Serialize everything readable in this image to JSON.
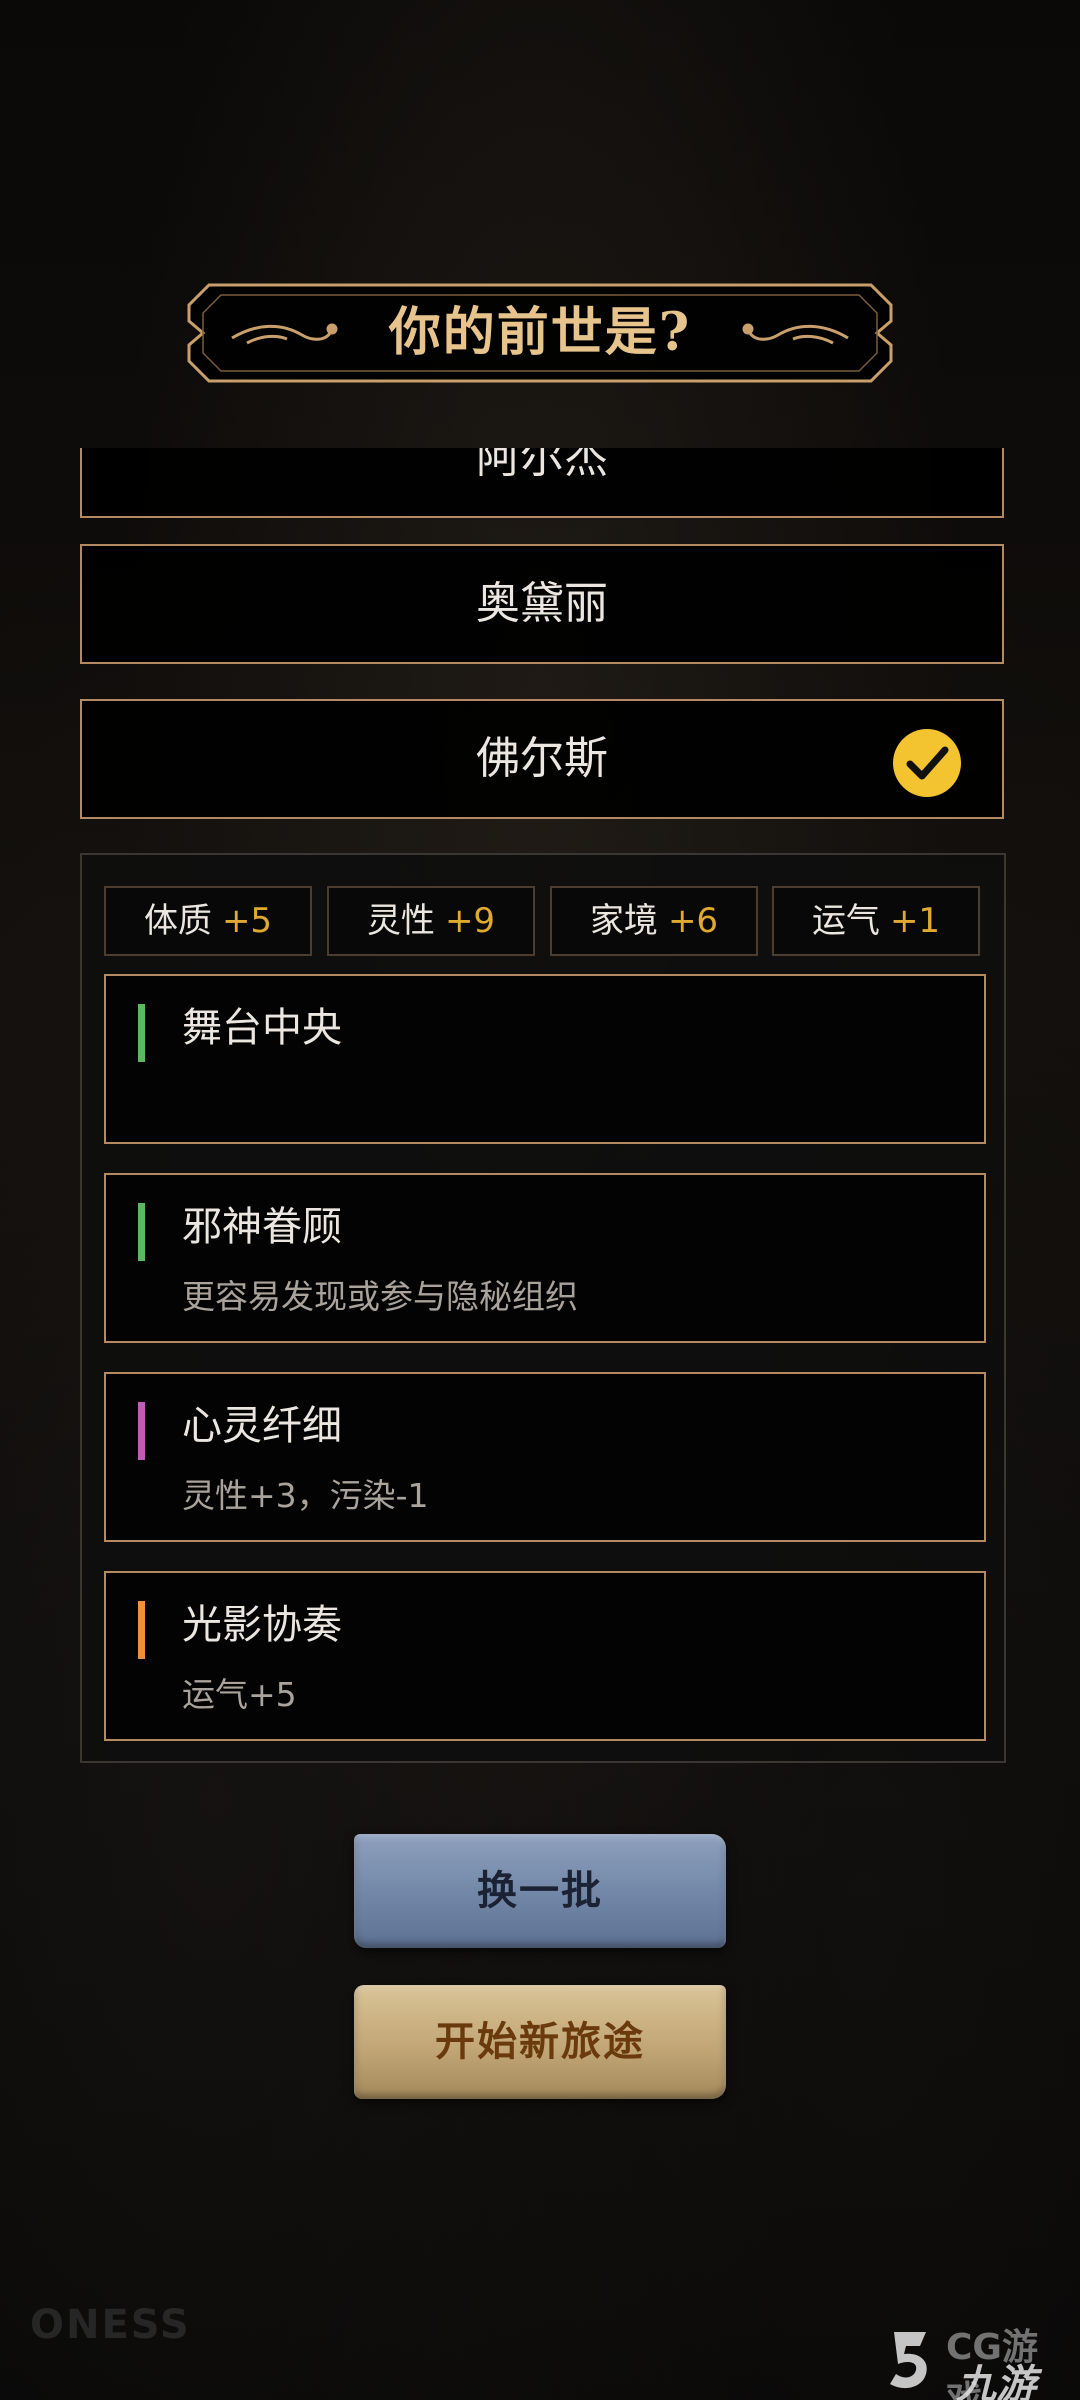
{
  "title": "你的前世是?",
  "options": [
    {
      "name": "阿尔杰",
      "selected": false
    },
    {
      "name": "奥黛丽",
      "selected": false
    },
    {
      "name": "佛尔斯",
      "selected": true
    }
  ],
  "stats": [
    {
      "label": "体质",
      "value": "+5"
    },
    {
      "label": "灵性",
      "value": "+9"
    },
    {
      "label": "家境",
      "value": "+6"
    },
    {
      "label": "运气",
      "value": "+1"
    }
  ],
  "traits": [
    {
      "name": "舞台中央",
      "desc": "",
      "color": "#5cb85c"
    },
    {
      "name": "邪神眷顾",
      "desc": "更容易发现或参与隐秘组织",
      "color": "#5cb85c"
    },
    {
      "name": "心灵纤细",
      "desc": "灵性+3，污染-1",
      "color": "#c05bb8"
    },
    {
      "name": "光影协奏",
      "desc": "运气+5",
      "color": "#f0903a"
    }
  ],
  "buttons": {
    "change_batch": "换一批",
    "start_journey": "开始新旅途"
  },
  "watermark": {
    "left_text": "ONESS",
    "site_text": "CG游戏",
    "brand_text": "九游"
  },
  "colors": {
    "accent_gold": "#e8c48d",
    "frame_border": "#b58a63",
    "stat_value": "#e0a930",
    "check_yellow": "#f4c430"
  },
  "icons": {
    "selected_marker": "checkmark-circle-icon",
    "title_ornaments": "flourish-icon"
  }
}
